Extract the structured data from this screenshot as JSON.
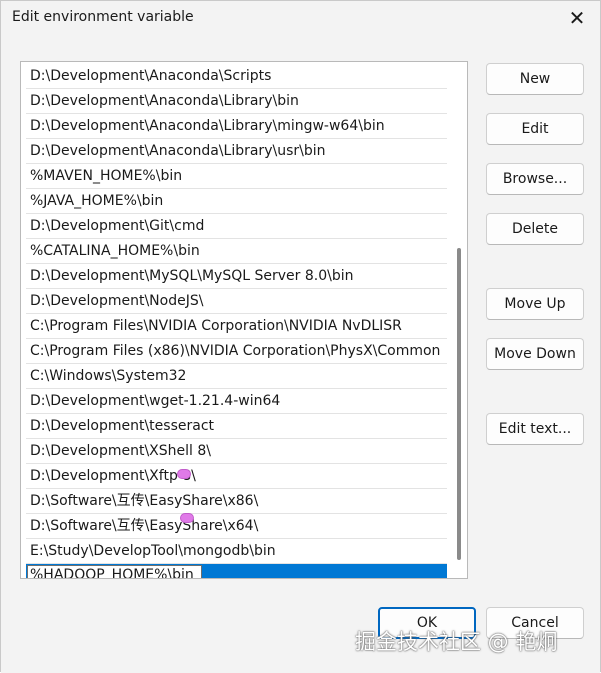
{
  "dialog": {
    "title": "Edit environment variable",
    "close_label": "✕"
  },
  "entries": [
    "D:\\Development\\Anaconda\\Scripts",
    "D:\\Development\\Anaconda\\Library\\bin",
    "D:\\Development\\Anaconda\\Library\\mingw-w64\\bin",
    "D:\\Development\\Anaconda\\Library\\usr\\bin",
    "%MAVEN_HOME%\\bin",
    "%JAVA_HOME%\\bin",
    "D:\\Development\\Git\\cmd",
    "%CATALINA_HOME%\\bin",
    "D:\\Development\\MySQL\\MySQL Server 8.0\\bin",
    "D:\\Development\\NodeJS\\",
    "C:\\Program Files\\NVIDIA Corporation\\NVIDIA NvDLISR",
    "C:\\Program Files (x86)\\NVIDIA Corporation\\PhysX\\Common",
    "C:\\Windows\\System32",
    "D:\\Development\\wget-1.21.4-win64",
    "D:\\Development\\tesseract",
    "D:\\Development\\XShell 8\\",
    "D:\\Development\\Xftp 8\\",
    "D:\\Software\\互传\\EasyShare\\x86\\",
    "D:\\Software\\互传\\EasyShare\\x64\\",
    "E:\\Study\\DevelopTool\\mongodb\\bin"
  ],
  "editing_entry": {
    "value": "%HADOOP_HOME%\\bin"
  },
  "buttons": {
    "new": "New",
    "edit": "Edit",
    "browse": "Browse...",
    "delete": "Delete",
    "move_up": "Move Up",
    "move_down": "Move Down",
    "edit_text": "Edit text...",
    "ok": "OK",
    "cancel": "Cancel"
  },
  "watermark": "掘金技术社区 @ 艳炯",
  "colors": {
    "selection": "#0078d4",
    "primary_border": "#0067c0"
  }
}
